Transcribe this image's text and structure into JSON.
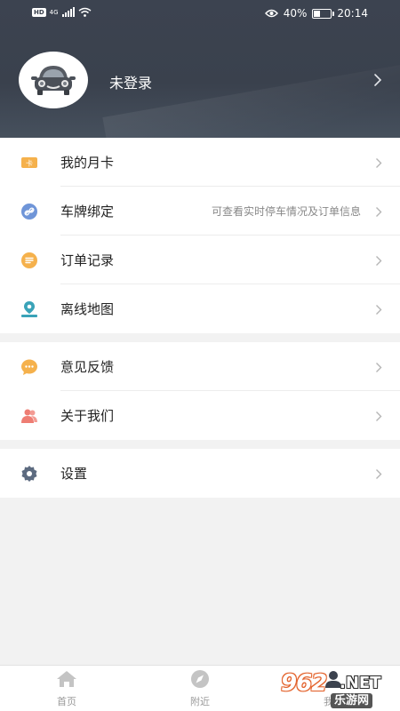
{
  "status_bar": {
    "hd": "HD",
    "network": "4G",
    "battery_percent": "40%",
    "battery_level": 0.4,
    "time": "20:14"
  },
  "profile": {
    "login_status": "未登录"
  },
  "menu_group_1": [
    {
      "label": "我的月卡",
      "hint": "",
      "icon": "card-icon",
      "color": "#f5b14c"
    },
    {
      "label": "车牌绑定",
      "hint": "可查看实时停车情况及订单信息",
      "icon": "link-icon",
      "color": "#6f95d8"
    },
    {
      "label": "订单记录",
      "hint": "",
      "icon": "list-icon",
      "color": "#f5b14c"
    },
    {
      "label": "离线地图",
      "hint": "",
      "icon": "map-pin-icon",
      "color": "#3aa3b8"
    }
  ],
  "menu_group_2": [
    {
      "label": "意见反馈",
      "hint": "",
      "icon": "chat-icon",
      "color": "#f5b14c"
    },
    {
      "label": "关于我们",
      "hint": "",
      "icon": "people-icon",
      "color": "#ee7d73"
    }
  ],
  "menu_group_3": [
    {
      "label": "设置",
      "hint": "",
      "icon": "gear-icon",
      "color": "#5d6b80"
    }
  ],
  "bottom_nav": [
    {
      "label": "首页",
      "icon": "home-icon"
    },
    {
      "label": "附近",
      "icon": "compass-icon"
    },
    {
      "label": "我的",
      "icon": "user-icon"
    }
  ],
  "watermark": {
    "number": "962",
    "tld": ".NET",
    "subtitle": "乐游网"
  }
}
